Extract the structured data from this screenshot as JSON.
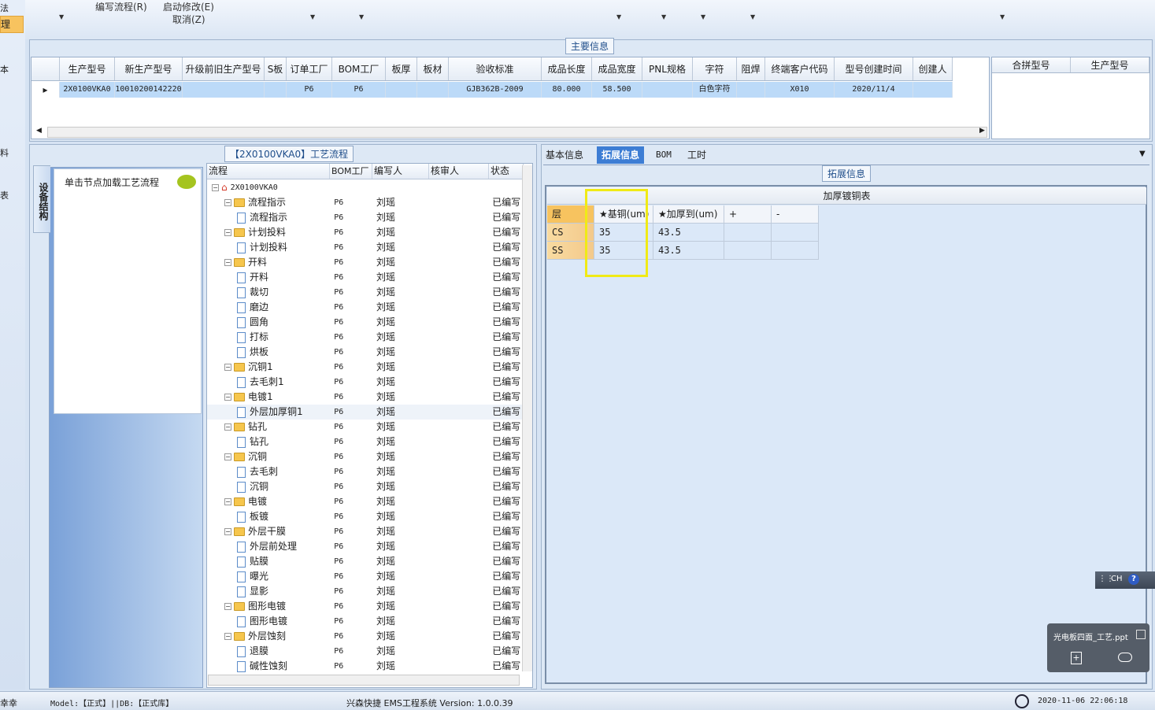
{
  "left_strip": {
    "items": [
      "法",
      "理",
      "本",
      "料",
      "表"
    ]
  },
  "toolbar": {
    "write_flow": "编写流程(R)",
    "start_modify": "启动修改(E)",
    "cancel": "取消(Z)"
  },
  "main_info": {
    "group_title": "主要信息",
    "columns": [
      "生产型号",
      "新生产型号",
      "升级前旧生产型号",
      "S板",
      "订单工厂",
      "BOM工厂",
      "板厚",
      "板材",
      "验收标准",
      "成品长度",
      "成品宽度",
      "PNL规格",
      "字符",
      "阻焊",
      "终端客户代码",
      "型号创建时间",
      "创建人"
    ],
    "row": [
      "2X0100VKA0",
      "10010200142220",
      "",
      "",
      "P6",
      "P6",
      "",
      "",
      "GJB362B-2009",
      "80.000",
      "58.500",
      "",
      "白色字符",
      "",
      "X010",
      "2020/11/4",
      ""
    ],
    "side_columns": [
      "合拼型号",
      "生产型号"
    ]
  },
  "process": {
    "group_title": "【2X0100VKA0】工艺流程",
    "vertical_tab": "设备结构",
    "node_hint": "单击节点加载工艺流程",
    "columns": [
      "流程",
      "BOM工厂",
      "编写人",
      "核审人",
      "状态"
    ],
    "rows": [
      {
        "name": "2X0100VKA0",
        "level": 0,
        "type": "root",
        "bom": "",
        "writer": "",
        "status": ""
      },
      {
        "name": "流程指示",
        "level": 1,
        "type": "folder",
        "bom": "P6",
        "writer": "刘瑶",
        "status": "已编写"
      },
      {
        "name": "流程指示",
        "level": 2,
        "type": "file",
        "bom": "P6",
        "writer": "刘瑶",
        "status": "已编写"
      },
      {
        "name": "计划投料",
        "level": 1,
        "type": "folder",
        "bom": "P6",
        "writer": "刘瑶",
        "status": "已编写"
      },
      {
        "name": "计划投料",
        "level": 2,
        "type": "file",
        "bom": "P6",
        "writer": "刘瑶",
        "status": "已编写"
      },
      {
        "name": "开料",
        "level": 1,
        "type": "folder",
        "bom": "P6",
        "writer": "刘瑶",
        "status": "已编写"
      },
      {
        "name": "开料",
        "level": 2,
        "type": "file",
        "bom": "P6",
        "writer": "刘瑶",
        "status": "已编写"
      },
      {
        "name": "裁切",
        "level": 2,
        "type": "file",
        "bom": "P6",
        "writer": "刘瑶",
        "status": "已编写"
      },
      {
        "name": "磨边",
        "level": 2,
        "type": "file",
        "bom": "P6",
        "writer": "刘瑶",
        "status": "已编写"
      },
      {
        "name": "圆角",
        "level": 2,
        "type": "file",
        "bom": "P6",
        "writer": "刘瑶",
        "status": "已编写"
      },
      {
        "name": "打标",
        "level": 2,
        "type": "file",
        "bom": "P6",
        "writer": "刘瑶",
        "status": "已编写"
      },
      {
        "name": "烘板",
        "level": 2,
        "type": "file",
        "bom": "P6",
        "writer": "刘瑶",
        "status": "已编写"
      },
      {
        "name": "沉铜1",
        "level": 1,
        "type": "folder",
        "bom": "P6",
        "writer": "刘瑶",
        "status": "已编写"
      },
      {
        "name": "去毛刺1",
        "level": 2,
        "type": "file",
        "bom": "P6",
        "writer": "刘瑶",
        "status": "已编写"
      },
      {
        "name": "电镀1",
        "level": 1,
        "type": "folder",
        "bom": "P6",
        "writer": "刘瑶",
        "status": "已编写"
      },
      {
        "name": "外层加厚铜1",
        "level": 2,
        "type": "file",
        "bom": "P6",
        "writer": "刘瑶",
        "status": "已编写",
        "selected": true
      },
      {
        "name": "钻孔",
        "level": 1,
        "type": "folder",
        "bom": "P6",
        "writer": "刘瑶",
        "status": "已编写"
      },
      {
        "name": "钻孔",
        "level": 2,
        "type": "file",
        "bom": "P6",
        "writer": "刘瑶",
        "status": "已编写"
      },
      {
        "name": "沉铜",
        "level": 1,
        "type": "folder",
        "bom": "P6",
        "writer": "刘瑶",
        "status": "已编写"
      },
      {
        "name": "去毛刺",
        "level": 2,
        "type": "file",
        "bom": "P6",
        "writer": "刘瑶",
        "status": "已编写"
      },
      {
        "name": "沉铜",
        "level": 2,
        "type": "file",
        "bom": "P6",
        "writer": "刘瑶",
        "status": "已编写"
      },
      {
        "name": "电镀",
        "level": 1,
        "type": "folder",
        "bom": "P6",
        "writer": "刘瑶",
        "status": "已编写"
      },
      {
        "name": "板镀",
        "level": 2,
        "type": "file",
        "bom": "P6",
        "writer": "刘瑶",
        "status": "已编写"
      },
      {
        "name": "外层干膜",
        "level": 1,
        "type": "folder",
        "bom": "P6",
        "writer": "刘瑶",
        "status": "已编写"
      },
      {
        "name": "外层前处理",
        "level": 2,
        "type": "file",
        "bom": "P6",
        "writer": "刘瑶",
        "status": "已编写"
      },
      {
        "name": "贴膜",
        "level": 2,
        "type": "file",
        "bom": "P6",
        "writer": "刘瑶",
        "status": "已编写"
      },
      {
        "name": "曝光",
        "level": 2,
        "type": "file",
        "bom": "P6",
        "writer": "刘瑶",
        "status": "已编写"
      },
      {
        "name": "显影",
        "level": 2,
        "type": "file",
        "bom": "P6",
        "writer": "刘瑶",
        "status": "已编写"
      },
      {
        "name": "图形电镀",
        "level": 1,
        "type": "folder",
        "bom": "P6",
        "writer": "刘瑶",
        "status": "已编写"
      },
      {
        "name": "图形电镀",
        "level": 2,
        "type": "file",
        "bom": "P6",
        "writer": "刘瑶",
        "status": "已编写"
      },
      {
        "name": "外层蚀刻",
        "level": 1,
        "type": "folder",
        "bom": "P6",
        "writer": "刘瑶",
        "status": "已编写"
      },
      {
        "name": "退膜",
        "level": 2,
        "type": "file",
        "bom": "P6",
        "writer": "刘瑶",
        "status": "已编写"
      },
      {
        "name": "碱性蚀刻",
        "level": 2,
        "type": "file",
        "bom": "P6",
        "writer": "刘瑶",
        "status": "已编写"
      }
    ]
  },
  "right": {
    "tabs": [
      "基本信息",
      "拓展信息",
      "BOM",
      "工时"
    ],
    "active_tab": "拓展信息",
    "group_title": "拓展信息",
    "table_title": "加厚镀铜表",
    "columns": [
      "层",
      "★基铜(um)",
      "★加厚到(um)",
      "+",
      "-"
    ],
    "rows": [
      [
        "CS",
        "35",
        "43.5",
        "",
        ""
      ],
      [
        "SS",
        "35",
        "43.5",
        "",
        ""
      ]
    ]
  },
  "ime": {
    "label": "CH"
  },
  "toast": {
    "filename": "光电板四面_工艺.ppt"
  },
  "status": {
    "left_text": "幸幸",
    "model": "Model:【正式】||DB:【正式库】",
    "app": "兴森快捷 EMS工程系统 Version: 1.0.0.39",
    "datetime": "2020-11-06 22:06:18"
  },
  "colors": {
    "selected_row": "#bcdaf8",
    "active_tab": "#3d7dd4",
    "highlight_box": "#f0ea16",
    "layer_cell": "#f7c35f"
  }
}
